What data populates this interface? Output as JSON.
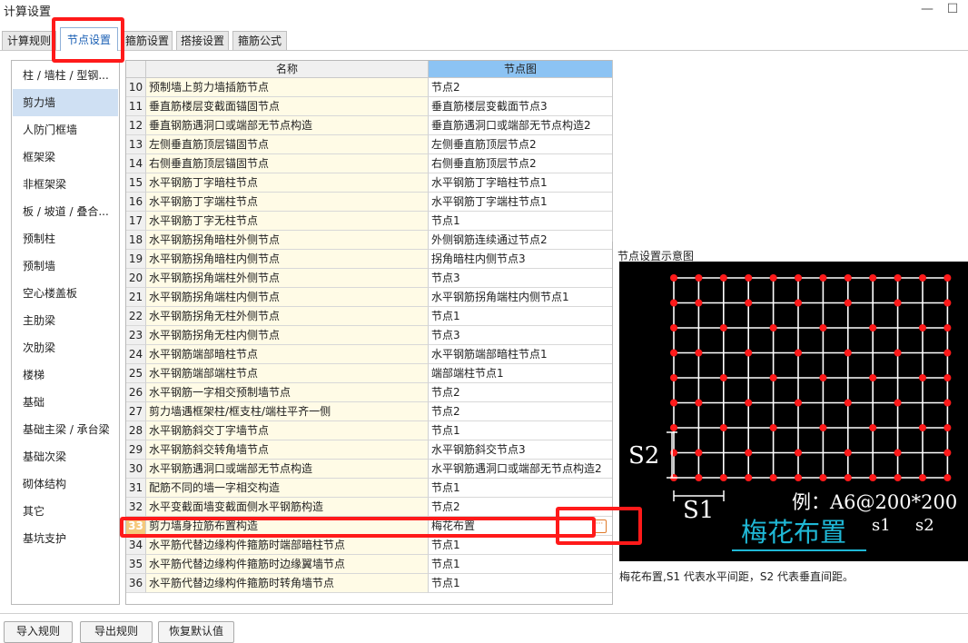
{
  "window": {
    "title": "计算设置",
    "minimize_label": "—",
    "maximize_label": "☐"
  },
  "tabs": [
    {
      "label": "计算规则"
    },
    {
      "label": "节点设置"
    },
    {
      "label": "箍筋设置"
    },
    {
      "label": "搭接设置"
    },
    {
      "label": "箍筋公式"
    }
  ],
  "active_tab_index": 1,
  "sidebar": {
    "selected_index": 1,
    "items": [
      {
        "label": "柱 / 墙柱 / 型钢..."
      },
      {
        "label": "剪力墙"
      },
      {
        "label": "人防门框墙"
      },
      {
        "label": "框架梁"
      },
      {
        "label": "非框架梁"
      },
      {
        "label": "板 / 坡道 / 叠合..."
      },
      {
        "label": "预制柱"
      },
      {
        "label": "预制墙"
      },
      {
        "label": "空心楼盖板"
      },
      {
        "label": "主肋梁"
      },
      {
        "label": "次肋梁"
      },
      {
        "label": "楼梯"
      },
      {
        "label": "基础"
      },
      {
        "label": "基础主梁 / 承台梁"
      },
      {
        "label": "基础次梁"
      },
      {
        "label": "砌体结构"
      },
      {
        "label": "其它"
      },
      {
        "label": "基坑支护"
      }
    ]
  },
  "grid": {
    "headers": {
      "name": "名称",
      "node": "节点图"
    },
    "selected_row_num": "33",
    "rows": [
      {
        "num": "10",
        "name": "预制墙上剪力墙插筋节点",
        "node": "节点2"
      },
      {
        "num": "11",
        "name": "垂直筋楼层变截面锚固节点",
        "node": "垂直筋楼层变截面节点3"
      },
      {
        "num": "12",
        "name": "垂直钢筋遇洞口或端部无节点构造",
        "node": "垂直筋遇洞口或端部无节点构造2"
      },
      {
        "num": "13",
        "name": "左侧垂直筋顶层锚固节点",
        "node": "左侧垂直筋顶层节点2"
      },
      {
        "num": "14",
        "name": "右侧垂直筋顶层锚固节点",
        "node": "右侧垂直筋顶层节点2"
      },
      {
        "num": "15",
        "name": "水平钢筋丁字暗柱节点",
        "node": "水平钢筋丁字暗柱节点1"
      },
      {
        "num": "16",
        "name": "水平钢筋丁字端柱节点",
        "node": "水平钢筋丁字端柱节点1"
      },
      {
        "num": "17",
        "name": "水平钢筋丁字无柱节点",
        "node": "节点1"
      },
      {
        "num": "18",
        "name": "水平钢筋拐角暗柱外侧节点",
        "node": "外侧钢筋连续通过节点2"
      },
      {
        "num": "19",
        "name": "水平钢筋拐角暗柱内侧节点",
        "node": "拐角暗柱内侧节点3"
      },
      {
        "num": "20",
        "name": "水平钢筋拐角端柱外侧节点",
        "node": "节点3"
      },
      {
        "num": "21",
        "name": "水平钢筋拐角端柱内侧节点",
        "node": "水平钢筋拐角端柱内侧节点1"
      },
      {
        "num": "22",
        "name": "水平钢筋拐角无柱外侧节点",
        "node": "节点1"
      },
      {
        "num": "23",
        "name": "水平钢筋拐角无柱内侧节点",
        "node": "节点3"
      },
      {
        "num": "24",
        "name": "水平钢筋端部暗柱节点",
        "node": "水平钢筋端部暗柱节点1"
      },
      {
        "num": "25",
        "name": "水平钢筋端部端柱节点",
        "node": "端部端柱节点1"
      },
      {
        "num": "26",
        "name": "水平钢筋一字相交预制墙节点",
        "node": "节点2"
      },
      {
        "num": "27",
        "name": "剪力墙遇框架柱/框支柱/端柱平齐一侧",
        "node": "节点2"
      },
      {
        "num": "28",
        "name": "水平钢筋斜交丁字墙节点",
        "node": "节点1"
      },
      {
        "num": "29",
        "name": "水平钢筋斜交转角墙节点",
        "node": "水平钢筋斜交节点3"
      },
      {
        "num": "30",
        "name": "水平钢筋遇洞口或端部无节点构造",
        "node": "水平钢筋遇洞口或端部无节点构造2"
      },
      {
        "num": "31",
        "name": "配筋不同的墙一字相交构造",
        "node": "节点1"
      },
      {
        "num": "32",
        "name": "水平变截面墙变截面侧水平钢筋构造",
        "node": "节点2"
      },
      {
        "num": "33",
        "name": "剪力墙身拉筋布置构造",
        "node": "梅花布置"
      },
      {
        "num": "34",
        "name": "水平筋代替边缘构件箍筋时端部暗柱节点",
        "node": "节点1"
      },
      {
        "num": "35",
        "name": "水平筋代替边缘构件箍筋时边缘翼墙节点",
        "node": "节点1"
      },
      {
        "num": "36",
        "name": "水平筋代替边缘构件箍筋时转角墙节点",
        "node": "节点1"
      }
    ],
    "more_button_label": "···"
  },
  "diagram": {
    "panel_title": "节点设置示意图",
    "s1_label": "S1",
    "s2_label": "S2",
    "example_label": "例：A6@200*200",
    "example_s1": "s1",
    "example_s2": "s2",
    "pattern_label": "梅花布置",
    "caption": "梅花布置,S1 代表水平间距，S2 代表垂直间距。",
    "colors": {
      "background": "#000000",
      "grid": "#ffffff",
      "dot": "#ff1a1a",
      "pattern_text": "#1fb8d6",
      "label": "#ffffff"
    }
  },
  "footer": {
    "buttons": [
      {
        "label": "导入规则"
      },
      {
        "label": "导出规则"
      },
      {
        "label": "恢复默认值"
      }
    ]
  },
  "highlight_color": "#ff1a1a"
}
